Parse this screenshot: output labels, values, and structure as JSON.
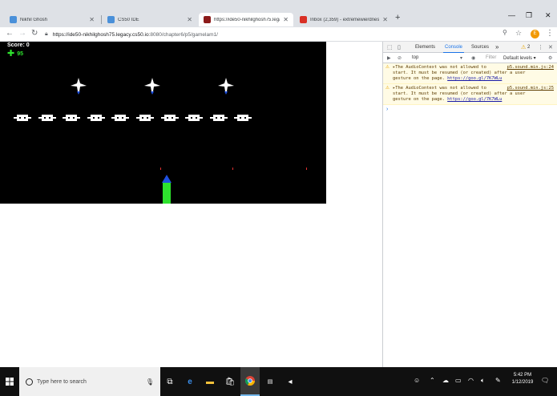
{
  "browser": {
    "tabs": [
      {
        "title": "Nikhil Ghosh",
        "fav_color": "#4a90d9"
      },
      {
        "title": "CS50 IDE",
        "fav_color": "#4a90d9"
      },
      {
        "title": "https://ide50-nikhilghosh75.legac",
        "fav_color": "#8b1a1a"
      },
      {
        "title": "Inbox (2,359) - extremewierdness",
        "fav_color": "#d93025"
      }
    ],
    "url_host": "https://ide50-nikhilghosh75.legacy.cs50.io",
    "url_path": ":8080/chapter6/p5/gamelam1/",
    "avatar_letter": "E"
  },
  "game": {
    "score_label": "Score: 0",
    "health_value": "95"
  },
  "devtools": {
    "tabs": [
      "Elements",
      "Console",
      "Sources"
    ],
    "more": "»",
    "warning_count": "2",
    "context": "top",
    "filter_placeholder": "Filter",
    "levels": "Default levels ▾",
    "messages": [
      {
        "text1": "▸The AudioContext was not allowed to",
        "src": "p5.sound.min.js:24",
        "text2": "start. It must be resumed (or created) after a user",
        "text3": "gesture on the page.",
        "link": "https://goo.gl/7K7WLu"
      },
      {
        "text1": "▸The AudioContext was not allowed to",
        "src": "p5.sound.min.js:25",
        "text2": "start. It must be resumed (or created) after a user",
        "text3": "gesture on the page.",
        "link": "https://goo.gl/7K7WLu"
      }
    ],
    "prompt": "›"
  },
  "taskbar": {
    "search_placeholder": "Type here to search",
    "time": "5:42 PM",
    "date": "1/12/2019"
  },
  "colors": {
    "accent": "#1a73e8",
    "player_body": "#2ee22e",
    "player_nose": "#1e50e0",
    "bullet": "#e03030"
  }
}
